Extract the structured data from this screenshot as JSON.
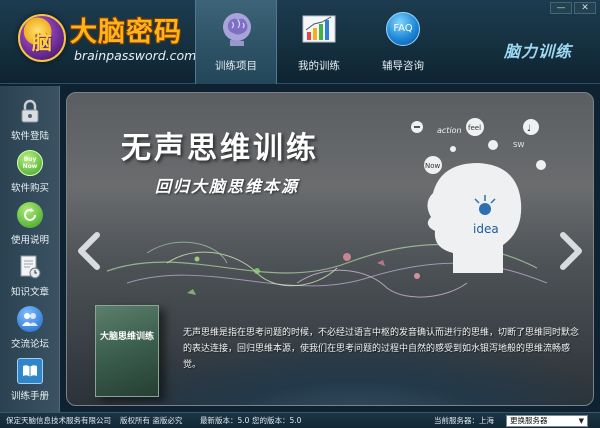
{
  "header": {
    "logo_glyph": "脑",
    "title": "大脑密码",
    "subtitle": "brainpassword.com",
    "slogan": "脑力训练",
    "nav": [
      {
        "label": "训练项目",
        "icon": "brain-head-icon",
        "active": true
      },
      {
        "label": "我的训练",
        "icon": "bar-chart-icon",
        "active": false
      },
      {
        "label": "辅导咨询",
        "icon": "faq-icon",
        "active": false,
        "icon_text": "FAQ"
      }
    ],
    "window_controls": {
      "minimize": "—",
      "close": "✕"
    }
  },
  "sidebar": {
    "items": [
      {
        "label": "软件登陆",
        "icon": "lock-icon"
      },
      {
        "label": "软件购买",
        "icon": "buy-now-icon",
        "icon_text": "Buy Now"
      },
      {
        "label": "使用说明",
        "icon": "refresh-icon"
      },
      {
        "label": "知识文章",
        "icon": "document-clock-icon"
      },
      {
        "label": "交流论坛",
        "icon": "users-icon"
      },
      {
        "label": "训练手册",
        "icon": "book-icon"
      }
    ]
  },
  "banner": {
    "title": "无声思维训练",
    "subtitle": "回归大脑思维本源",
    "bubble_words": [
      "action",
      "feel",
      "SW",
      "Now",
      "idea"
    ],
    "product_box_text": "大脑思维训练",
    "description": "无声思维是指在思考问题的时候，不必经过语言中枢的发音确认而进行的思维，切断了思维同时默念的表达连接，回归思维本源，使我们在思考问题的过程中自然的感受到如水银泻地般的思维流畅感觉。"
  },
  "statusbar": {
    "company": "保定天脑信息技术服务有限公司",
    "rights": "版权所有  盗版必究",
    "latest_version": "最新版本：5.0",
    "your_version": "您的版本：5.0",
    "current_server": "当前服务器：上海",
    "server_select": "更换服务器"
  },
  "colors": {
    "accent": "#ffb31a",
    "header_bg": "#15303f",
    "sidebar_bg": "#2a4251",
    "banner_bg": "#5b5e61"
  }
}
